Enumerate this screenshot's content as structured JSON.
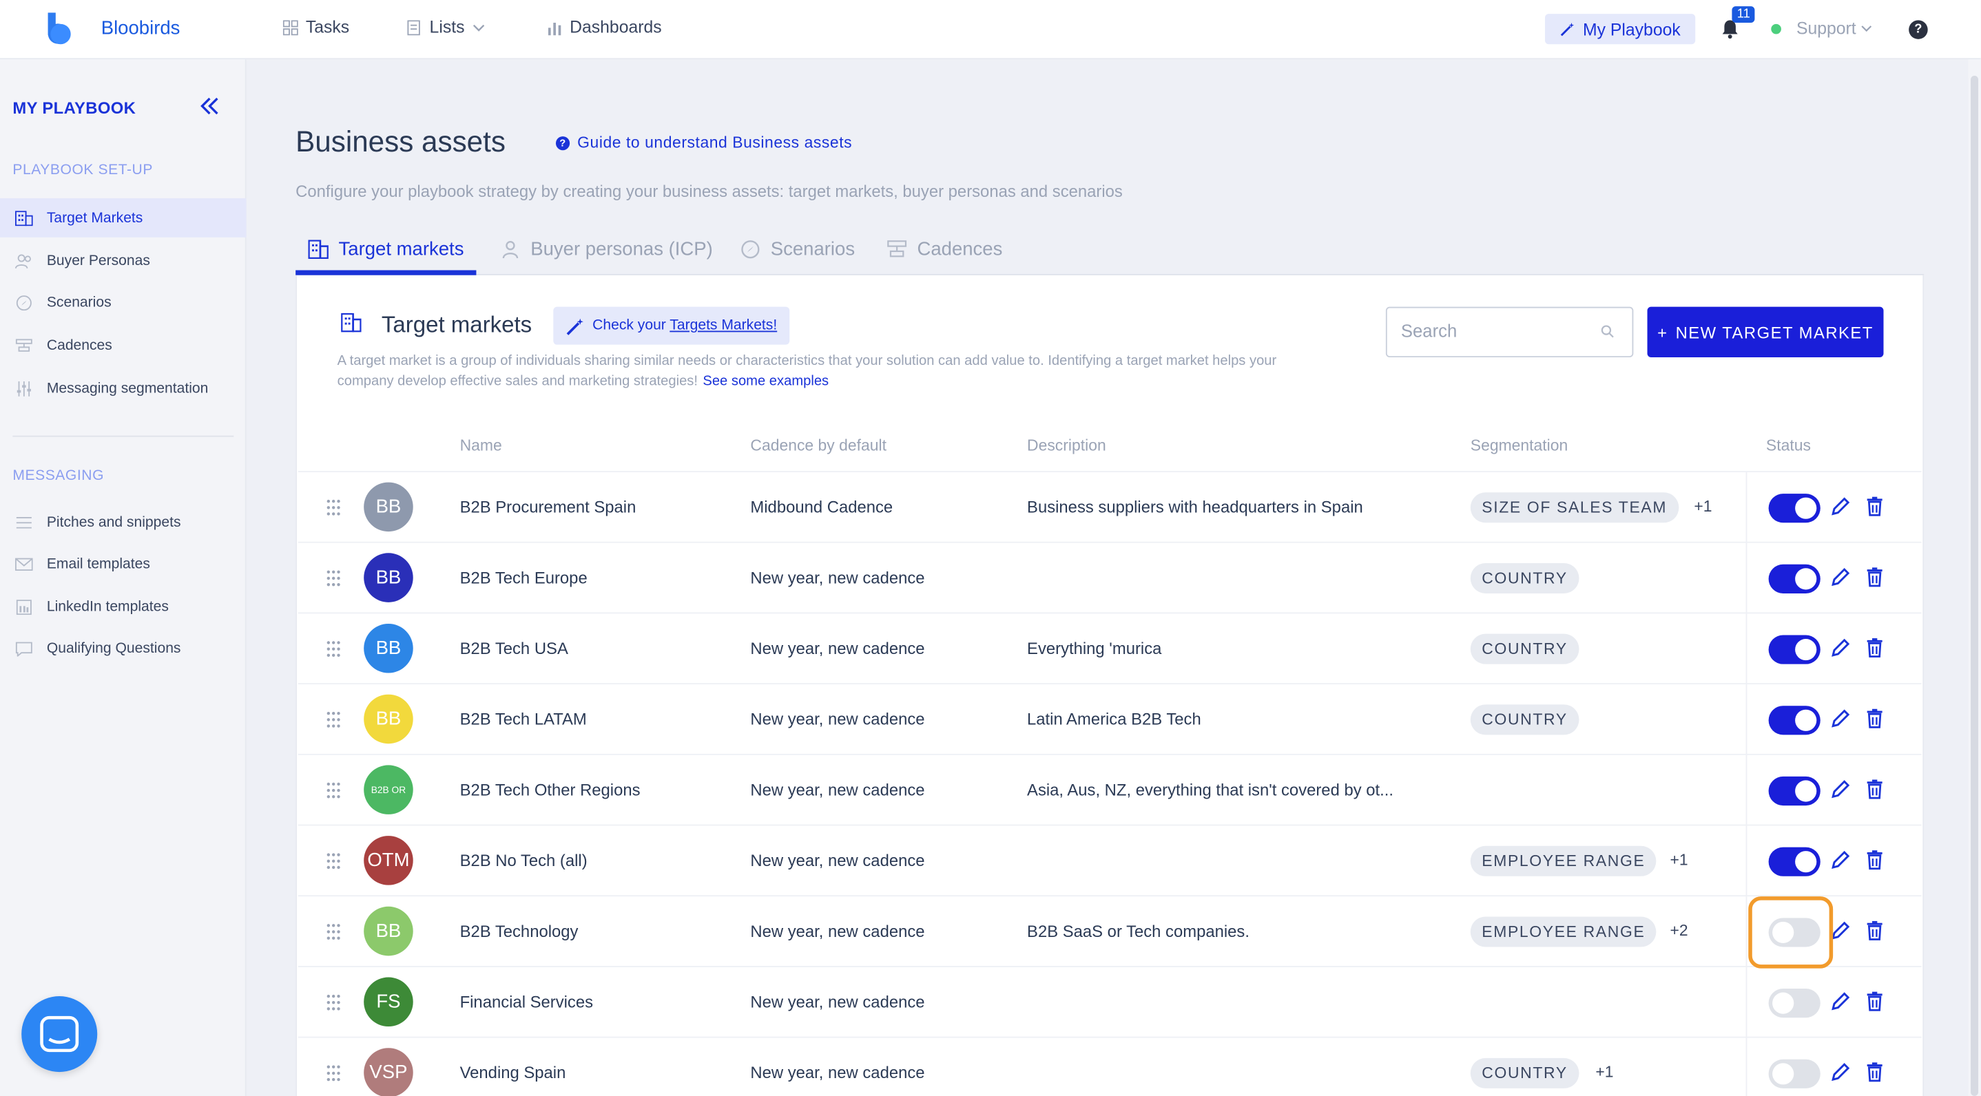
{
  "app": {
    "brand": "Bloobirds"
  },
  "topnav": {
    "tasks": "Tasks",
    "lists": "Lists",
    "dashboards": "Dashboards",
    "my_playbook": "My Playbook",
    "notifications_count": "11",
    "support": "Support",
    "help": "?"
  },
  "sidebar": {
    "title": "MY PLAYBOOK",
    "setup_section": "PLAYBOOK SET-UP",
    "setup_items": [
      {
        "label": "Target Markets",
        "icon": "building-icon"
      },
      {
        "label": "Buyer Personas",
        "icon": "people-icon"
      },
      {
        "label": "Scenarios",
        "icon": "compass-icon"
      },
      {
        "label": "Cadences",
        "icon": "cadence-icon"
      },
      {
        "label": "Messaging segmentation",
        "icon": "sliders-icon"
      }
    ],
    "messaging_section": "MESSAGING",
    "messaging_items": [
      {
        "label": "Pitches and snippets",
        "icon": "lines-icon"
      },
      {
        "label": "Email templates",
        "icon": "mail-icon"
      },
      {
        "label": "LinkedIn templates",
        "icon": "linkedin-icon"
      },
      {
        "label": "Qualifying Questions",
        "icon": "chat-icon"
      }
    ]
  },
  "page": {
    "title": "Business assets",
    "guide_link": "Guide to understand Business assets",
    "subtitle": "Configure your playbook strategy by creating your business assets: target markets, buyer personas and scenarios",
    "tabs": [
      "Target markets",
      "Buyer personas (ICP)",
      "Scenarios",
      "Cadences"
    ]
  },
  "card": {
    "title": "Target markets",
    "check_prefix": "Check your ",
    "check_link": "Targets Markets!",
    "description": "A target market is a group of individuals sharing similar needs or characteristics that your solution can add value to. Identifying a target market helps your company develop effective sales and marketing strategies!",
    "examples_link": "See some examples",
    "search_placeholder": "Search",
    "new_button": "NEW TARGET MARKET"
  },
  "table": {
    "headers": {
      "name": "Name",
      "cadence": "Cadence by default",
      "description": "Description",
      "segmentation": "Segmentation",
      "status": "Status"
    },
    "rows": [
      {
        "avatar": "BB",
        "color": "#8e99ad",
        "name": "B2B Procurement Spain",
        "cadence": "Midbound Cadence",
        "description": "Business suppliers with headquarters in Spain",
        "chip": "SIZE OF SALES TEAM",
        "extra": "+1",
        "active": true
      },
      {
        "avatar": "BB",
        "color": "#2a2fb8",
        "name": "B2B Tech Europe",
        "cadence": "New year, new cadence",
        "description": "",
        "chip": "COUNTRY",
        "extra": "",
        "active": true
      },
      {
        "avatar": "BB",
        "color": "#2d86e6",
        "name": "B2B Tech USA",
        "cadence": "New year, new cadence",
        "description": "Everything 'murica",
        "chip": "COUNTRY",
        "extra": "",
        "active": true
      },
      {
        "avatar": "BB",
        "color": "#f2d93c",
        "name": "B2B Tech LATAM",
        "cadence": "New year, new cadence",
        "description": "Latin America B2B Tech",
        "chip": "COUNTRY",
        "extra": "",
        "active": true
      },
      {
        "avatar": "B2B OR",
        "color": "#4cb863",
        "name": "B2B Tech Other Regions",
        "cadence": "New year, new cadence",
        "description": "Asia, Aus, NZ, everything that isn't covered by ot...",
        "chip": "",
        "extra": "",
        "active": true
      },
      {
        "avatar": "OTM",
        "color": "#a8403f",
        "name": "B2B No Tech (all)",
        "cadence": "New year, new cadence",
        "description": "",
        "chip": "EMPLOYEE RANGE",
        "extra": "+1",
        "active": true
      },
      {
        "avatar": "BB",
        "color": "#8cc96b",
        "name": "B2B Technology",
        "cadence": "New year, new cadence",
        "description": "B2B SaaS or Tech companies.",
        "chip": "EMPLOYEE RANGE",
        "extra": "+2",
        "active": false
      },
      {
        "avatar": "FS",
        "color": "#3d8a37",
        "name": "Financial Services",
        "cadence": "New year, new cadence",
        "description": "",
        "chip": "",
        "extra": "",
        "active": false
      },
      {
        "avatar": "VSP",
        "color": "#b07c7c",
        "name": "Vending Spain",
        "cadence": "New year, new cadence",
        "description": "",
        "chip": "COUNTRY",
        "extra": "+1",
        "active": false
      }
    ]
  },
  "colors": {
    "accent": "#1a33d8",
    "button": "#1a1fd9",
    "highlight": "#f29b2c"
  }
}
